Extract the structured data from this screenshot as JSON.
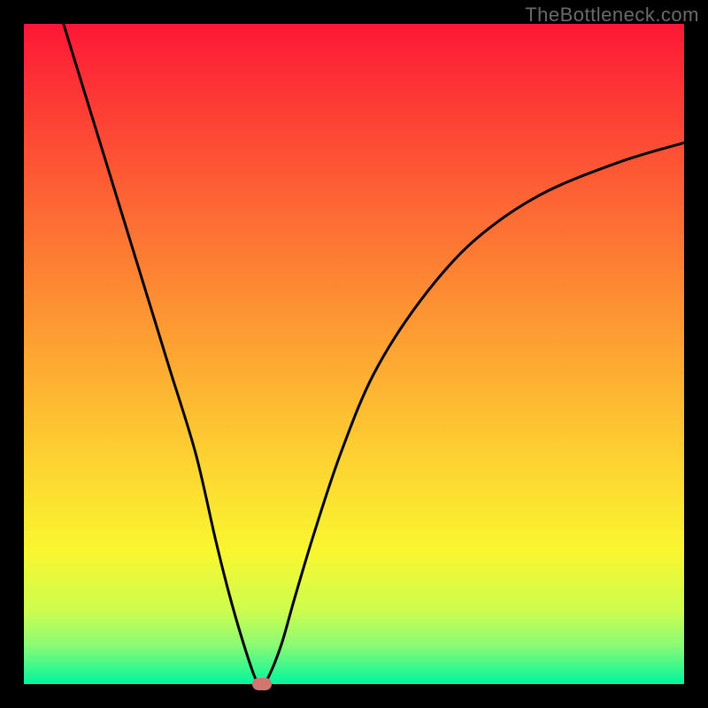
{
  "watermark": {
    "text": "TheBottleneck.com"
  },
  "chart_data": {
    "type": "line",
    "title": "",
    "xlabel": "",
    "ylabel": "",
    "xlim": [
      0,
      100
    ],
    "ylim": [
      0,
      100
    ],
    "series": [
      {
        "name": "curve",
        "x": [
          6,
          10,
          14,
          18,
          22,
          26,
          29,
          31,
          33,
          35,
          36,
          37,
          39,
          41,
          44,
          48,
          53,
          60,
          68,
          78,
          90,
          100
        ],
        "values": [
          100,
          87,
          74,
          61,
          48,
          35,
          22,
          14,
          7,
          1,
          0,
          1,
          6,
          13,
          23,
          35,
          47,
          58,
          67,
          74,
          79,
          82
        ]
      }
    ],
    "marker": {
      "x": 36,
      "y": 0
    },
    "gradient_stops": [
      {
        "pct": 0,
        "color": "#fd1736"
      },
      {
        "pct": 50,
        "color": "#fd9f33"
      },
      {
        "pct": 80,
        "color": "#f9f730"
      },
      {
        "pct": 100,
        "color": "#00f59f"
      }
    ]
  }
}
